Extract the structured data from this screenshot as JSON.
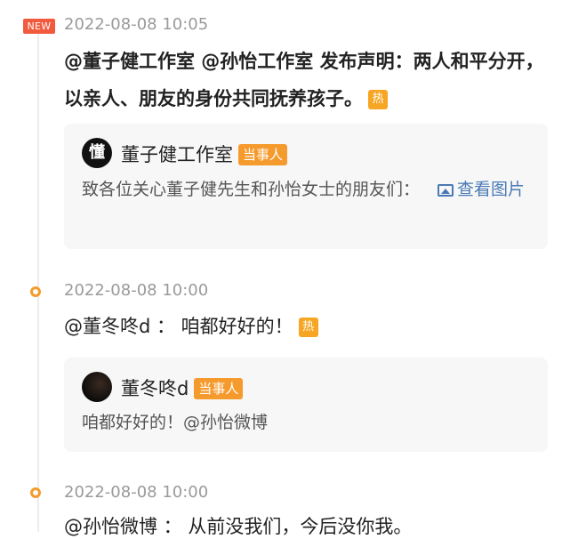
{
  "entries": [
    {
      "badge": "NEW",
      "time": "2022-08-08 10:05",
      "title": "@董子健工作室 @孙怡工作室 发布声明：两人和平分开，以亲人、朋友的身份共同抚养孩子。",
      "hot_label": "热",
      "card": {
        "avatar_char": "懂",
        "author": "董子健工作室",
        "party_label": "当事人",
        "text": "致各位关心董子健先生和孙怡女士的朋友们：",
        "link_text": "查看图片"
      }
    },
    {
      "time": "2022-08-08 10:00",
      "title": "@董冬咚d ： 咱都好好的！",
      "hot_label": "热",
      "card": {
        "author": "董冬咚d",
        "party_label": "当事人",
        "text": "咱都好好的！@孙怡微博"
      }
    },
    {
      "time": "2022-08-08 10:00",
      "title": "@孙怡微博 ： 从前没我们，今后没你我。"
    }
  ]
}
